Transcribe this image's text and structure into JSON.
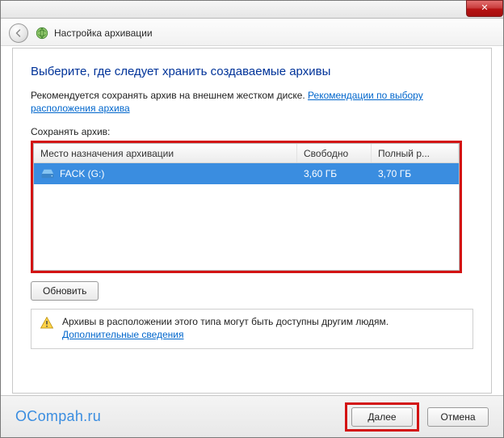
{
  "window": {
    "close_glyph": "✕",
    "title": "Настройка архивации"
  },
  "main": {
    "heading": "Выберите, где следует хранить создаваемые архивы",
    "recommendation_text": "Рекомендуется сохранять архив на внешнем жестком диске. ",
    "recommendation_link": "Рекомендации по выбору расположения архива",
    "save_label": "Сохранять архив:"
  },
  "table": {
    "headers": {
      "destination": "Место назначения архивации",
      "free": "Свободно",
      "total": "Полный р..."
    },
    "rows": [
      {
        "drive_name": "FACK (G:)",
        "free": "3,60 ГБ",
        "total": "3,70 ГБ"
      }
    ]
  },
  "refresh_label": "Обновить",
  "warning": {
    "text": "Архивы в расположении этого типа могут быть доступны другим людям.",
    "link": "Дополнительные сведения"
  },
  "footer": {
    "watermark": "OCompah.ru",
    "next": "Далее",
    "cancel": "Отмена"
  }
}
